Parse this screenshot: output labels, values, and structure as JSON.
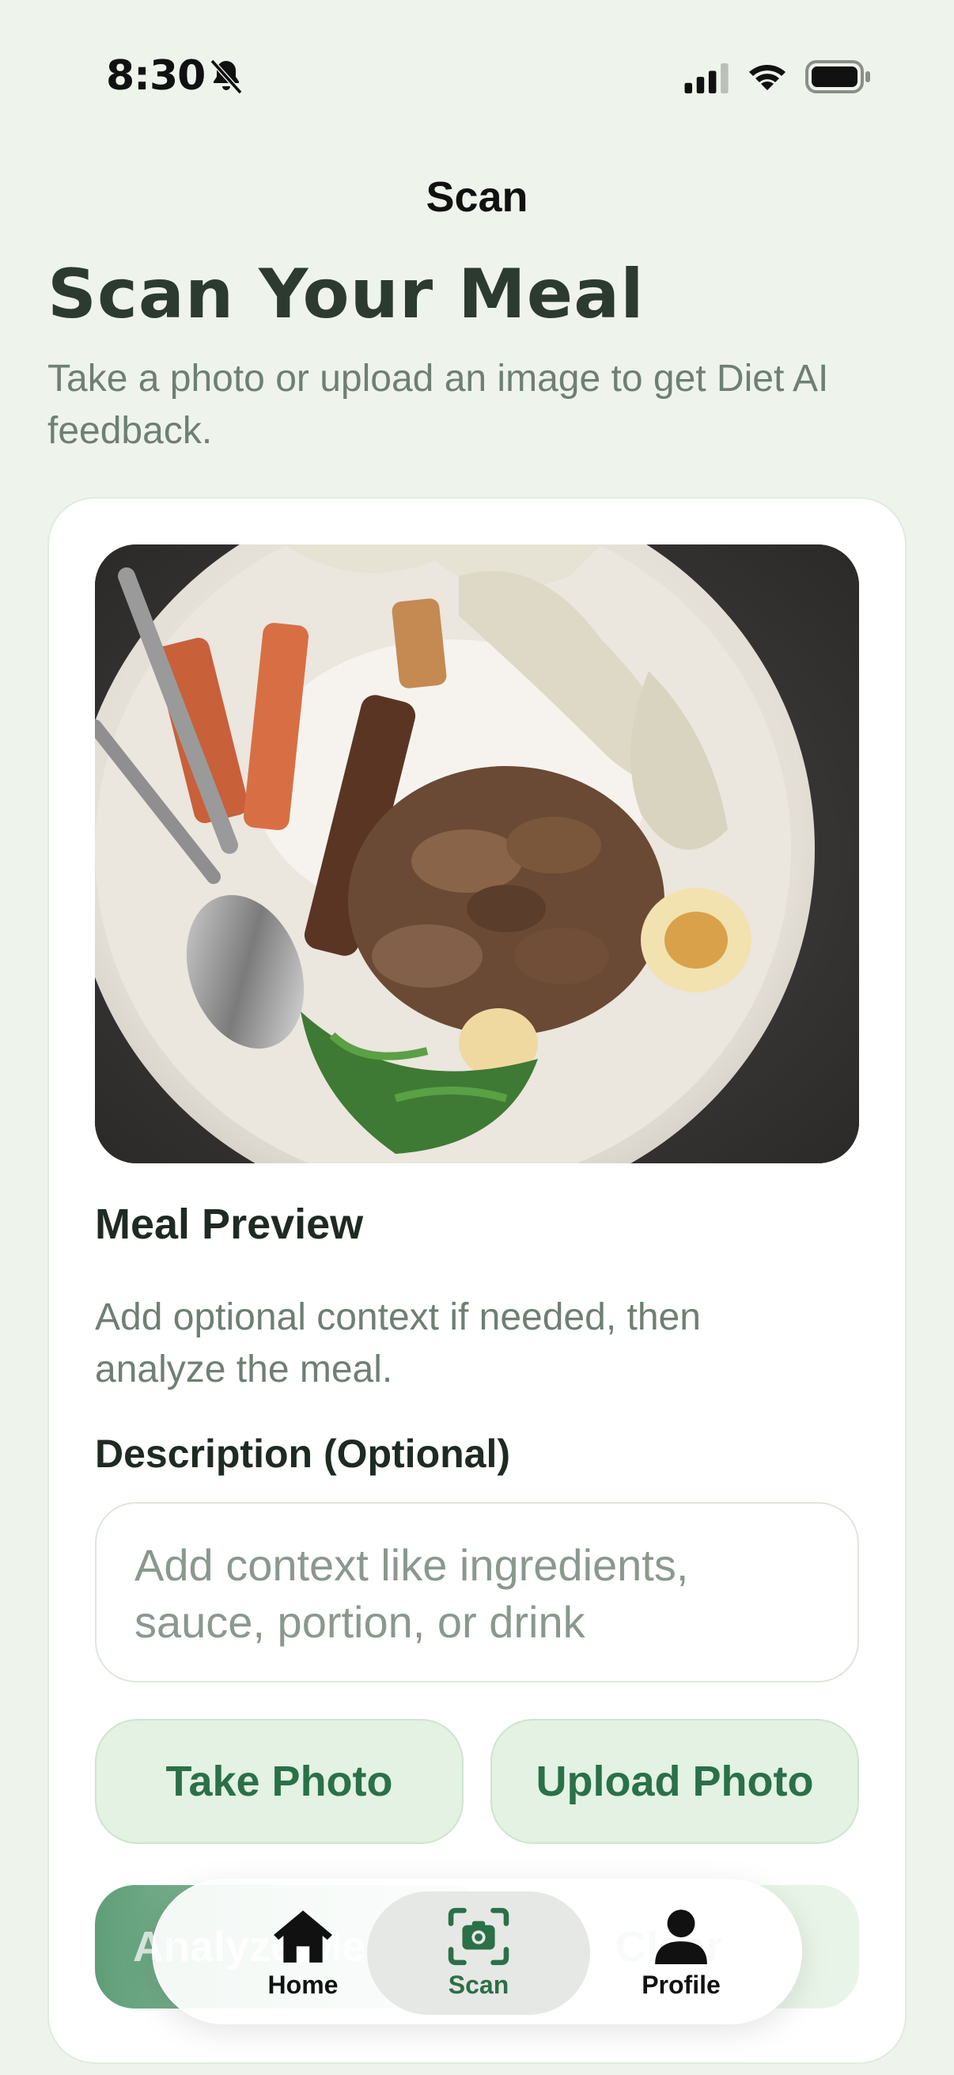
{
  "status_bar": {
    "time": "8:30",
    "icons": [
      "bell-slash-icon",
      "signal-icon",
      "wifi-icon",
      "battery-icon"
    ]
  },
  "nav": {
    "title": "Scan"
  },
  "header": {
    "heading": "Scan Your Meal",
    "subtitle": "Take a photo or upload an image to get Diet AI feedback."
  },
  "preview": {
    "title": "Meal Preview",
    "description": "Add optional context if needed, then analyze the meal."
  },
  "description_field": {
    "label": "Description (Optional)",
    "placeholder": "Add context like ingredients, sauce, portion, or drink",
    "value": ""
  },
  "actions": {
    "take_photo": "Take Photo",
    "upload_photo": "Upload Photo",
    "analyze": "Analyze Meal",
    "clear": "Clear"
  },
  "tab_bar": {
    "items": [
      {
        "label": "Home",
        "icon": "house-icon",
        "active": false
      },
      {
        "label": "Scan",
        "icon": "camera-viewfinder-icon",
        "active": true
      },
      {
        "label": "Profile",
        "icon": "person-icon",
        "active": false
      }
    ]
  },
  "colors": {
    "background": "#eef4ec",
    "accent": "#2a7048",
    "button_fill": "#e3f2e2"
  }
}
